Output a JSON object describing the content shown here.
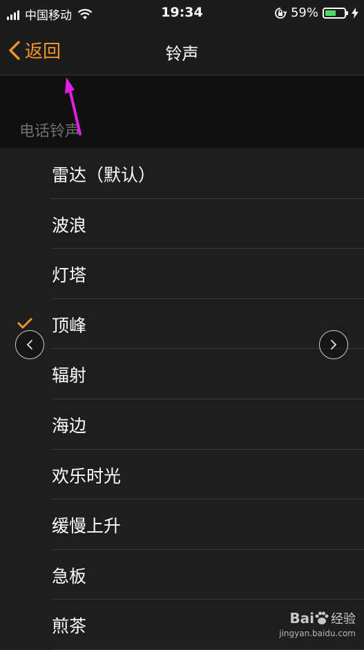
{
  "status_bar": {
    "carrier": "中国移动",
    "time": "19:34",
    "battery_percent": "59%",
    "battery_level": 0.59,
    "icons": [
      "signal-icon",
      "wifi-icon",
      "orientation-lock-icon",
      "battery-icon",
      "charging-icon"
    ]
  },
  "nav": {
    "back_label": "返回",
    "title": "铃声"
  },
  "section": {
    "header": "电话铃声"
  },
  "ringtones": [
    {
      "label": "雷达（默认）",
      "selected": false
    },
    {
      "label": "波浪",
      "selected": false
    },
    {
      "label": "灯塔",
      "selected": false
    },
    {
      "label": "顶峰",
      "selected": true
    },
    {
      "label": "辐射",
      "selected": false
    },
    {
      "label": "海边",
      "selected": false
    },
    {
      "label": "欢乐时光",
      "selected": false
    },
    {
      "label": "缓慢上升",
      "selected": false
    },
    {
      "label": "急板",
      "selected": false
    },
    {
      "label": "煎茶",
      "selected": false
    }
  ],
  "watermark": {
    "brand": "Bai",
    "brand_suffix": "经验",
    "url": "jingyan.baidu.com"
  },
  "colors": {
    "accent": "#f0962b",
    "annotation_arrow": "#e020e0",
    "battery_green": "#4cd964"
  }
}
